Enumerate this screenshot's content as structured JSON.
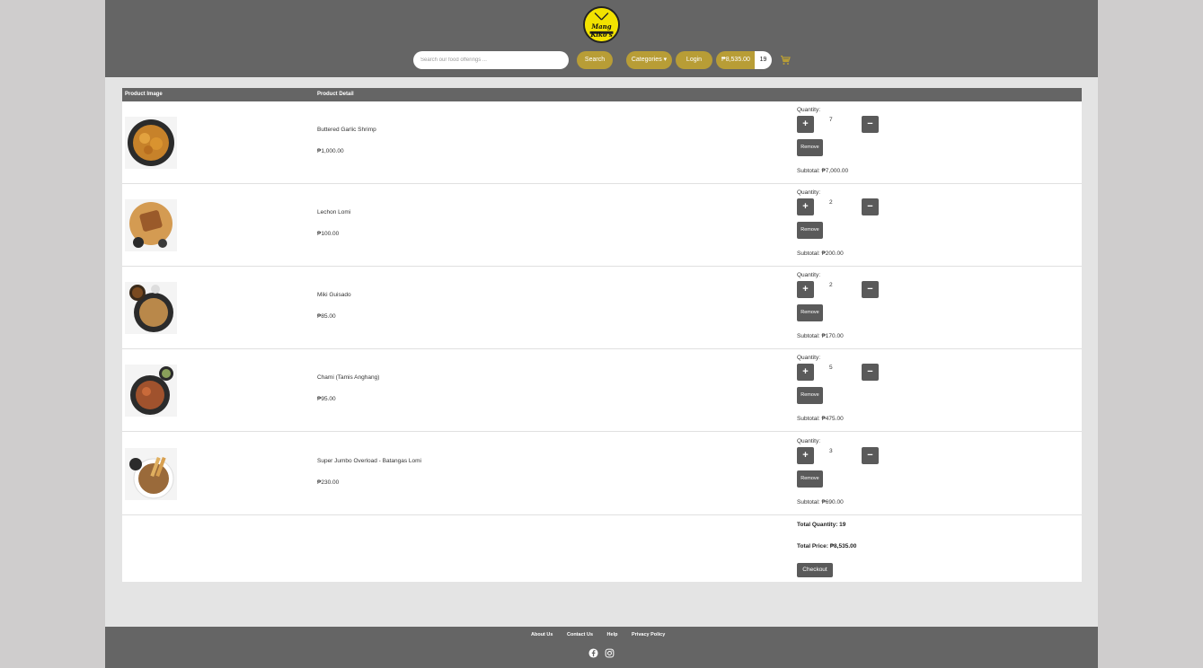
{
  "header": {
    "logo_text": "Mang Kiko's",
    "search_placeholder": "Search our food offerings ...",
    "search_label": "Search",
    "categories_label": "Categories ▾",
    "login_label": "Login",
    "cart_total": "₱8,535.00",
    "cart_count": "19"
  },
  "table": {
    "col_image": "Product Image",
    "col_detail": "Product Detail"
  },
  "labels": {
    "quantity": "Quantity:",
    "plus": "+",
    "minus": "−",
    "remove": "Remove"
  },
  "items": [
    {
      "name": "Buttered Garlic Shrimp",
      "price": "₱1,000.00",
      "qty": "7",
      "subtotal": "Subtotal: ₱7,000.00"
    },
    {
      "name": "Lechon Lomi",
      "price": "₱100.00",
      "qty": "2",
      "subtotal": "Subtotal: ₱200.00"
    },
    {
      "name": "Miki Guisado",
      "price": "₱85.00",
      "qty": "2",
      "subtotal": "Subtotal: ₱170.00"
    },
    {
      "name": "Chami (Tamis Anghang)",
      "price": "₱95.00",
      "qty": "5",
      "subtotal": "Subtotal: ₱475.00"
    },
    {
      "name": "Super Jumbo Overload - Batangas Lomi",
      "price": "₱230.00",
      "qty": "3",
      "subtotal": "Subtotal: ₱690.00"
    }
  ],
  "summary": {
    "total_quantity": "Total Quantity: 19",
    "total_price": "Total Price: ₱8,535.00",
    "checkout_label": "Checkout"
  },
  "footer": {
    "links": [
      "About Us",
      "Contact Us",
      "Help",
      "Privacy Policy"
    ],
    "social": [
      "facebook-icon",
      "instagram-icon"
    ]
  },
  "colors": {
    "header_bg": "#656565",
    "accent": "#b89d36",
    "button_dark": "#5a5a5a",
    "logo_yellow": "#f2e200"
  }
}
